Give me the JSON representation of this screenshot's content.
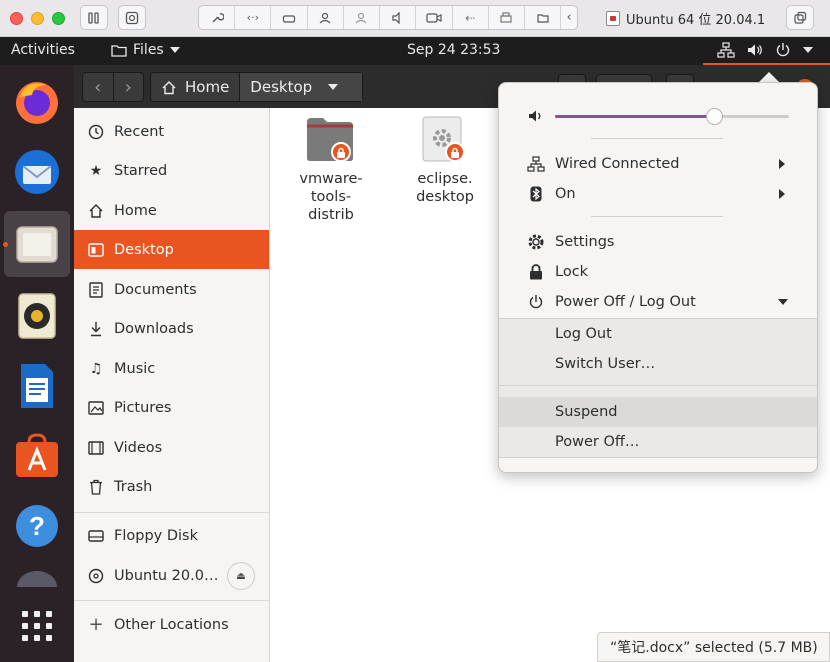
{
  "host": {
    "vm_title": "Ubuntu 64 位 20.04.1"
  },
  "panel": {
    "activities": "Activities",
    "app_menu": "Files",
    "clock": "Sep 24  23:53"
  },
  "header": {
    "path": [
      "Home",
      "Desktop"
    ]
  },
  "sidebar": {
    "items": [
      {
        "label": "Recent",
        "icon": "clock-icon"
      },
      {
        "label": "Starred",
        "icon": "star-icon"
      },
      {
        "label": "Home",
        "icon": "home-icon"
      },
      {
        "label": "Desktop",
        "icon": "desktop-icon",
        "selected": true
      },
      {
        "label": "Documents",
        "icon": "document-icon"
      },
      {
        "label": "Downloads",
        "icon": "download-icon"
      },
      {
        "label": "Music",
        "icon": "music-icon"
      },
      {
        "label": "Pictures",
        "icon": "picture-icon"
      },
      {
        "label": "Videos",
        "icon": "video-icon"
      },
      {
        "label": "Trash",
        "icon": "trash-icon"
      }
    ],
    "devices": [
      {
        "label": "Floppy Disk",
        "icon": "drive-icon"
      },
      {
        "label": "Ubuntu 20.0…",
        "icon": "disc-icon"
      }
    ],
    "other": {
      "label": "Other Locations",
      "icon": "plus-icon"
    }
  },
  "files": [
    {
      "name": "vmware-\ntools-\ndistrib",
      "icon": "folder-icon"
    },
    {
      "name": "eclipse.\ndesktop",
      "icon": "gear-file-icon"
    }
  ],
  "status": "“笔记.docx” selected  (5.7 MB)",
  "system_menu": {
    "volume_level": 0.68,
    "network": "Wired Connected",
    "bluetooth": "On",
    "settings": "Settings",
    "lock": "Lock",
    "power": "Power Off / Log Out",
    "submenu": [
      "Log Out",
      "Switch User…",
      "Suspend",
      "Power Off…"
    ]
  },
  "colors": {
    "accent": "#e95420",
    "slider": "#924d8b"
  }
}
